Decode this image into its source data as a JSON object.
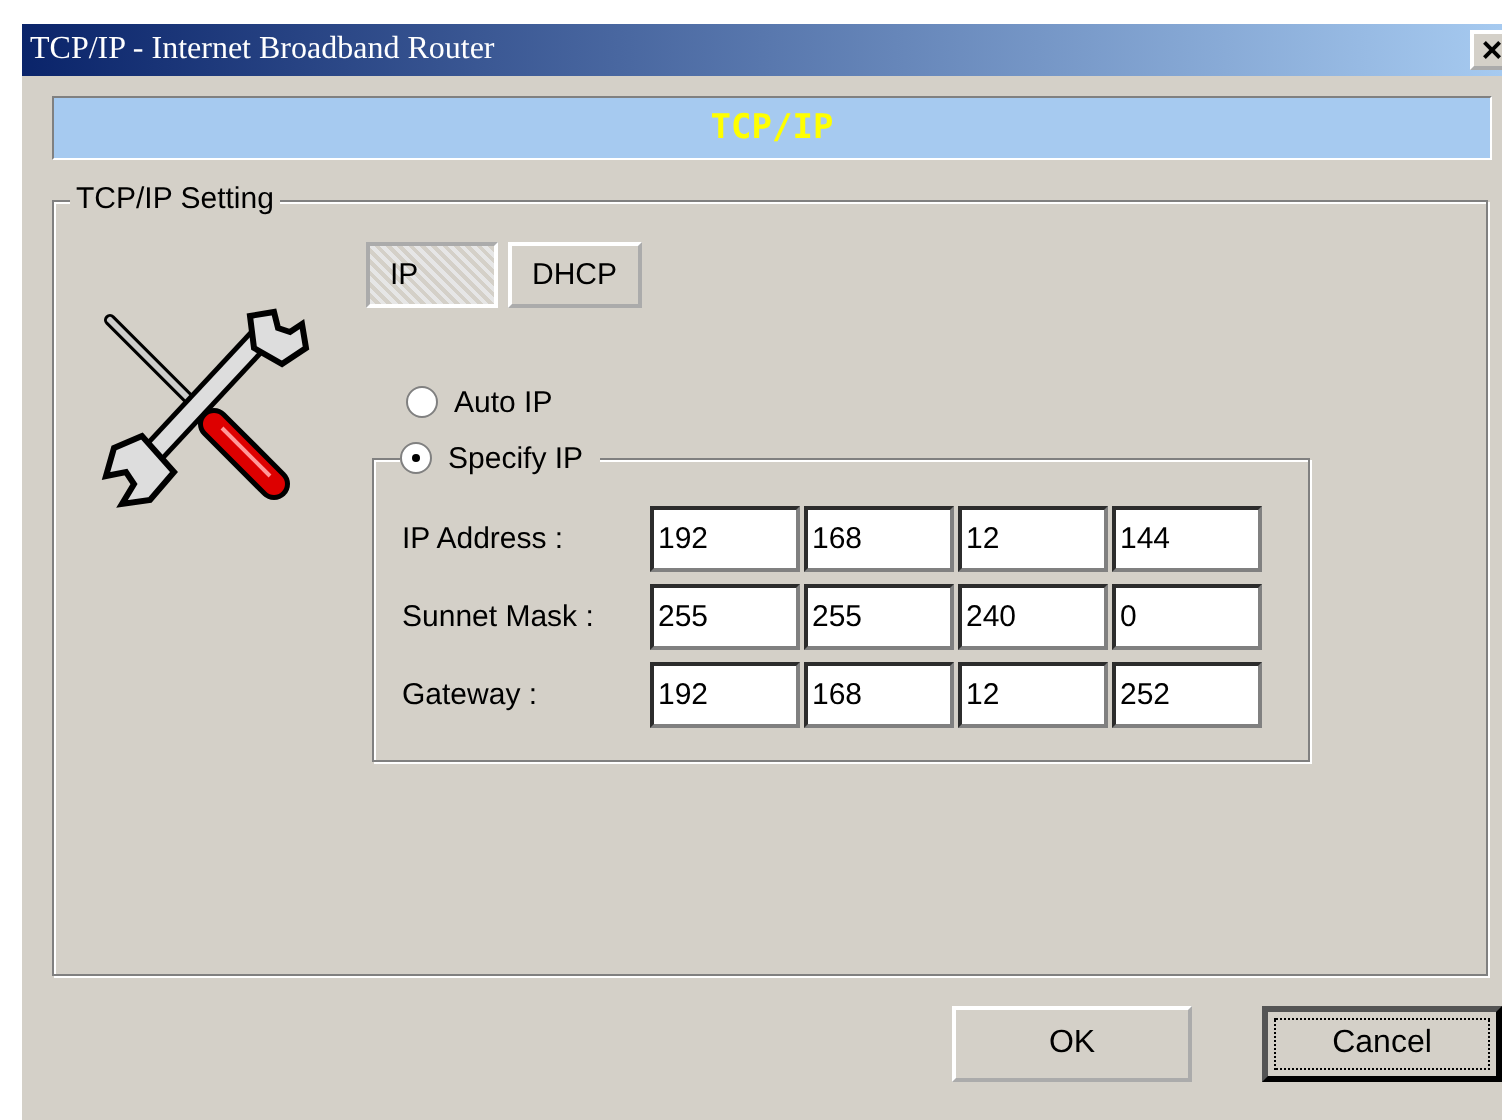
{
  "window": {
    "title": "TCP/IP - Internet Broadband Router",
    "close": "×"
  },
  "banner": "TCP/IP",
  "group": {
    "title": "TCP/IP Setting"
  },
  "tabs": [
    {
      "label": "IP",
      "selected": true
    },
    {
      "label": "DHCP",
      "selected": false
    }
  ],
  "modes": [
    {
      "label": "Auto IP",
      "selected": false
    },
    {
      "label": "Specify IP",
      "selected": true
    }
  ],
  "fields": [
    {
      "label": "IP Address :",
      "values": [
        "192",
        "168",
        "12",
        "144"
      ]
    },
    {
      "label": "Sunnet Mask :",
      "values": [
        "255",
        "255",
        "240",
        "0"
      ]
    },
    {
      "label": "Gateway :",
      "values": [
        "192",
        "168",
        "12",
        "252"
      ]
    }
  ],
  "buttons": [
    {
      "label": "OK",
      "focused": false
    },
    {
      "label": "Cancel",
      "focused": true
    }
  ]
}
